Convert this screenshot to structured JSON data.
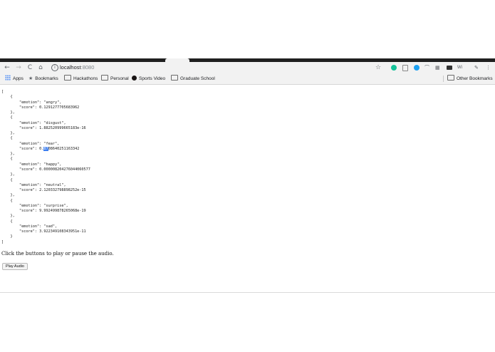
{
  "browser": {
    "url_host": "localhost",
    "url_port": ":8080",
    "nav": {
      "back": "←",
      "forward": "→",
      "reload": "C",
      "home": "⌂"
    },
    "toolbar_icons": [
      "star-icon",
      "grammarly-icon",
      "bookmark-extension-icon",
      "blue-circle-extension-icon",
      "wave-extension-icon",
      "extension-icon",
      "cast-icon",
      "wi-extension-icon",
      "pin-icon",
      "menu-icon"
    ],
    "ext_label_wi": "Wi",
    "menu_glyph": "⋮",
    "colors": {
      "grammarly": "#15c39a",
      "blue_extension": "#1da1f2",
      "tab_strip": "#1f1f1f",
      "selection": "#3d7ff0"
    }
  },
  "bookmarks": {
    "apps": "Apps",
    "items": [
      "Bookmarks",
      "Hackathons",
      "Personal",
      "Sports Video",
      "Graduate School"
    ],
    "other": "Other Bookmarks"
  },
  "json_output": {
    "open": "[",
    "entries": [
      {
        "emotion": "angry",
        "score": "0.1291277705683962"
      },
      {
        "emotion": "disgust",
        "score": "1.882520999665183e-16"
      },
      {
        "emotion": "fear",
        "score_prefix": "0.",
        "score_selected": "87",
        "score_rest": "08640251163342"
      },
      {
        "emotion": "happy",
        "score": "0.000008204276044060577"
      },
      {
        "emotion": "neutral",
        "score": "2.120332798898252e-15"
      },
      {
        "emotion": "surprise",
        "score": "9.992499878265068e-19"
      },
      {
        "emotion": "sad",
        "score": "3.922349108343951e-11"
      }
    ],
    "close": "]"
  },
  "page": {
    "instruction": "Click the buttons to play or pause the audio.",
    "play_button": "Play Audio"
  }
}
